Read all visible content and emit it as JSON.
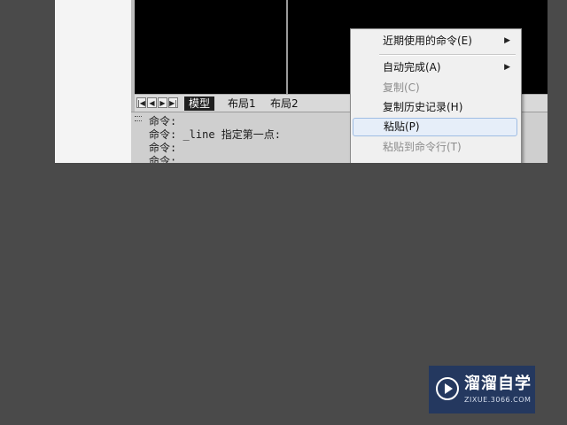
{
  "layout_tabs": {
    "nav_icons": [
      "first-tab-icon",
      "prev-tab-icon",
      "next-tab-icon",
      "last-tab-icon"
    ],
    "nav_glyphs": [
      "|◀",
      "◀",
      "▶",
      "▶|"
    ],
    "model": "模型",
    "layout1": "布局1",
    "layout2": "布局2"
  },
  "command_line": {
    "lines": [
      "命令:",
      "命令: _line 指定第一点:",
      "命令:",
      "命令:"
    ]
  },
  "context_menu": {
    "items": [
      {
        "label": "近期使用的命令(E)",
        "submenu": true,
        "enabled": true
      },
      {
        "label": "自动完成(A)",
        "submenu": true,
        "enabled": true
      },
      {
        "label": "复制(C)",
        "submenu": false,
        "enabled": false
      },
      {
        "label": "复制历史记录(H)",
        "submenu": false,
        "enabled": true
      },
      {
        "label": "粘贴(P)",
        "submenu": false,
        "enabled": true,
        "highlighted": true
      },
      {
        "label": "粘贴到命令行(T)",
        "submenu": false,
        "enabled": false
      }
    ]
  },
  "watermark": {
    "title": "溜溜自学",
    "url": "ZIXUE.3066.COM",
    "color": "#24385f"
  }
}
